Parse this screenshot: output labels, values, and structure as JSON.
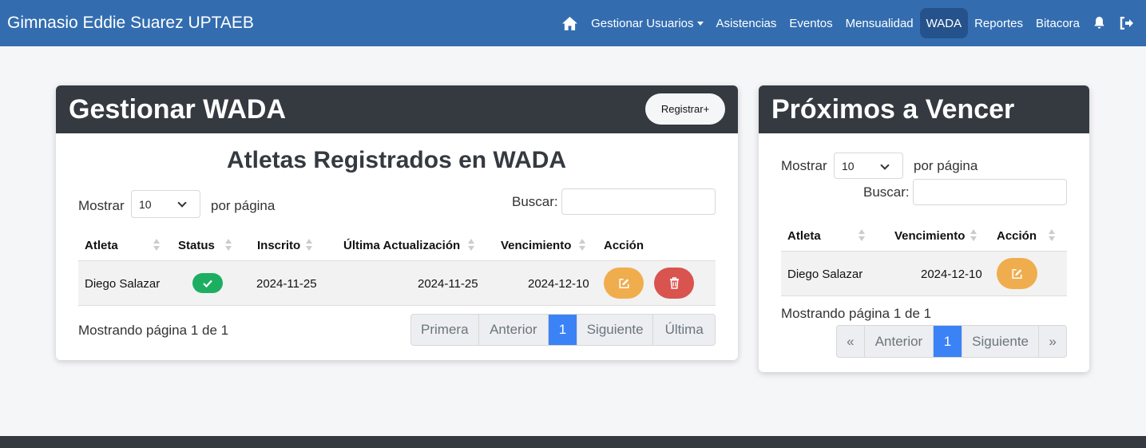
{
  "brand": "Gimnasio Eddie Suarez UPTAEB",
  "nav": {
    "home_icon": "home-icon",
    "users": "Gestionar Usuarios",
    "attendance": "Asistencias",
    "events": "Eventos",
    "monthly": "Mensualidad",
    "wada": "WADA",
    "reports": "Reportes",
    "log": "Bitacora",
    "bell_icon": "bell-icon",
    "logout_icon": "logout-icon"
  },
  "wada_card": {
    "title": "Gestionar WADA",
    "register_button": "Registrar+",
    "subtitle": "Atletas Registrados en WADA",
    "show_label": "Mostrar",
    "page_size": "10",
    "per_page_label": "por página",
    "search_label": "Buscar:",
    "search_value": "",
    "columns": [
      "Atleta",
      "Status",
      "Inscrito",
      "Última Actualización",
      "Vencimiento",
      "Acción"
    ],
    "rows": [
      {
        "atleta": "Diego Salazar",
        "status": "check",
        "inscrito": "2024-11-25",
        "actualizacion": "2024-11-25",
        "vencimiento": "2024-12-10"
      }
    ],
    "info": "Mostrando página 1 de 1",
    "pagination": [
      "Primera",
      "Anterior",
      "1",
      "Siguiente",
      "Última"
    ]
  },
  "expiring_card": {
    "title": "Próximos a Vencer",
    "show_label": "Mostrar",
    "page_size": "10",
    "per_page_label": "por página",
    "search_label": "Buscar:",
    "search_value": "",
    "columns": [
      "Atleta",
      "Vencimiento",
      "Acción"
    ],
    "rows": [
      {
        "atleta": "Diego Salazar",
        "vencimiento": "2024-12-10"
      }
    ],
    "info": "Mostrando página 1 de 1",
    "pagination": [
      "«",
      "Anterior",
      "1",
      "Siguiente",
      "»"
    ]
  },
  "colors": {
    "navbar": "#336db0",
    "card_header": "#343a40",
    "success": "#1dae62",
    "warning": "#f0ad4e",
    "danger": "#d9534f",
    "active_page": "#3b82f6"
  }
}
